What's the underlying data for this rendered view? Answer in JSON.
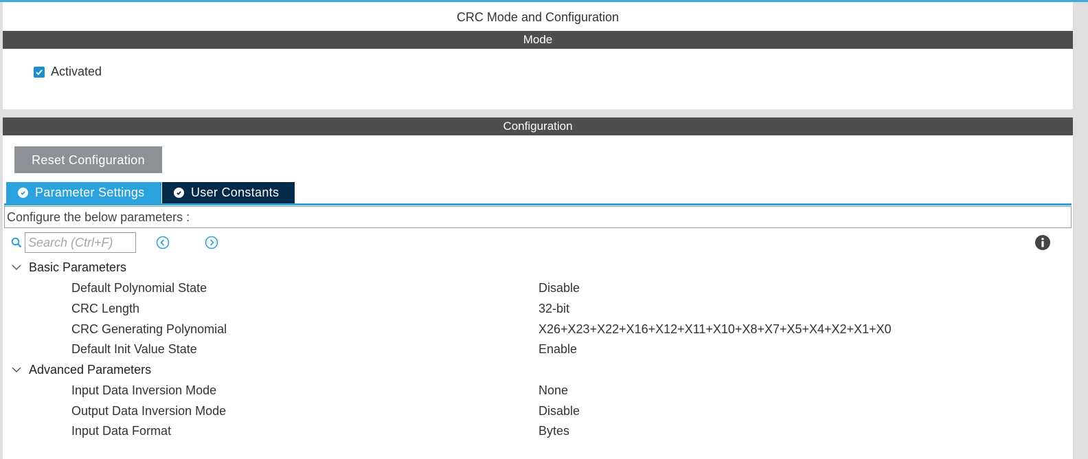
{
  "window": {
    "title": "CRC Mode and Configuration"
  },
  "mode": {
    "header": "Mode",
    "activated_label": "Activated",
    "activated_checked": true
  },
  "configuration": {
    "header": "Configuration",
    "reset_button": "Reset Configuration",
    "tabs": [
      {
        "label": "Parameter Settings",
        "active": true
      },
      {
        "label": "User Constants",
        "active": false
      }
    ],
    "description": "Configure the below parameters :",
    "search": {
      "placeholder": "Search (Ctrl+F)",
      "value": ""
    },
    "groups": [
      {
        "label": "Basic Parameters",
        "params": [
          {
            "name": "Default Polynomial State",
            "value": "Disable"
          },
          {
            "name": "CRC Length",
            "value": "32-bit"
          },
          {
            "name": "CRC Generating Polynomial",
            "value": "X26+X23+X22+X16+X12+X11+X10+X8+X7+X5+X4+X2+X1+X0"
          },
          {
            "name": "Default Init Value State",
            "value": "Enable"
          }
        ]
      },
      {
        "label": "Advanced Parameters",
        "params": [
          {
            "name": "Input Data Inversion Mode",
            "value": "None"
          },
          {
            "name": "Output Data Inversion Mode",
            "value": "Disable"
          },
          {
            "name": "Input Data Format",
            "value": "Bytes"
          }
        ]
      }
    ]
  },
  "colors": {
    "accent": "#2aa3dd",
    "tab_inactive": "#032a4a",
    "header_bar": "#4e4e4e",
    "button_gray": "#8d9195",
    "checkbox": "#1c8fd1"
  },
  "icons": {
    "tab_status": "check-circle-icon",
    "search": "search-icon",
    "prev": "circle-chevron-left-icon",
    "next": "circle-chevron-right-icon",
    "info": "info-icon",
    "group_toggle": "chevron-down-icon"
  }
}
